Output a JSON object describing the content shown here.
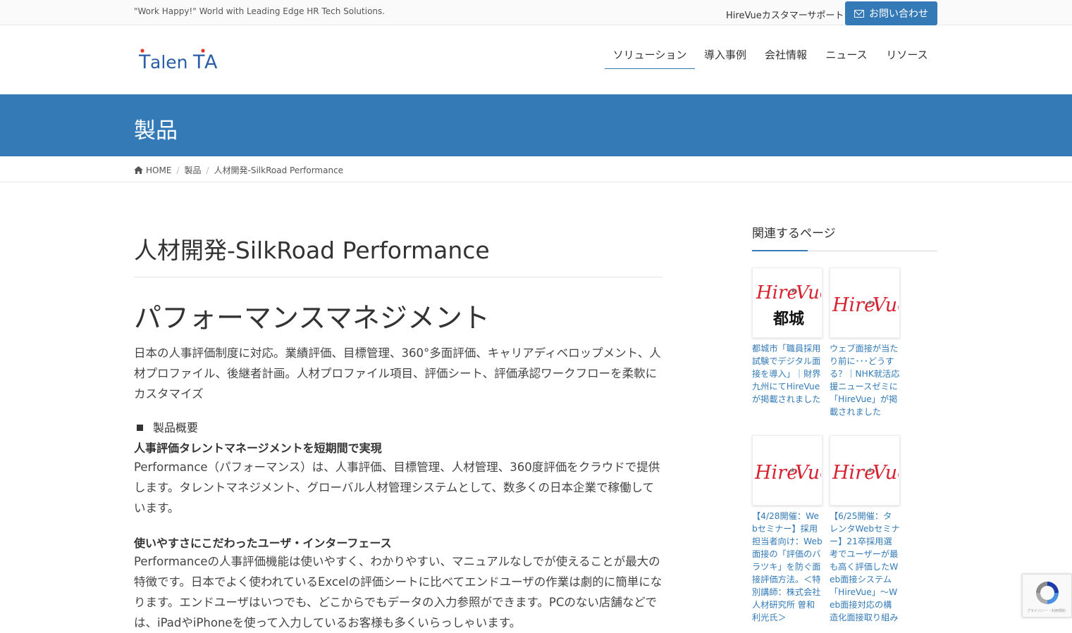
{
  "topbar": {
    "tagline": "\"Work Happy!\" World with Leading Edge HR Tech Solutions.",
    "support_link": "HireVueカスタマーサポート",
    "contact_button": "お問い合わせ"
  },
  "brand": {
    "logo_text": "TalenTA",
    "colors": {
      "primary": "#337ab7",
      "logo_blue": "#2a5ea8",
      "logo_red": "#e8332a"
    }
  },
  "nav": {
    "items": [
      {
        "label": "ソリューション",
        "active": true
      },
      {
        "label": "導入事例"
      },
      {
        "label": "会社情報"
      },
      {
        "label": "ニュース"
      },
      {
        "label": "リソース"
      }
    ]
  },
  "band": {
    "title": "製品"
  },
  "breadcrumb": {
    "home": "HOME",
    "level1": "製品",
    "current": "人材開発-SilkRoad Performance"
  },
  "main": {
    "page_title": "人材開発-SilkRoad Performance",
    "heading": "パフォーマンスマネジメント",
    "lead": "日本の人事評価制度に対応。業績評価、目標管理、360°多面評価、キャリアディベロップメント、人材プロファイル、後継者計画。人材プロファイル項目、評価シート、評価承認ワークフローを柔軟にカスタマイズ",
    "overview_label": "製品概要",
    "section1_heading": "人事評価タレントマネージメントを短期間で実現",
    "section1_body": "Performance（パフォーマンス）は、人事評価、目標管理、人材管理、360度評価をクラウドで提供します。タレントマネジメント、グローバル人材管理システムとして、数多くの日本企業で稼働しています。",
    "section2_heading": "使いやすさにこだわったユーザ・インターフェース",
    "section2_body": "Performanceの人事評価機能は使いやすく、わかりやすい、マニュアルなしでが使えることが最大の特徴です。日本でよく使われているExcelの評価シートに比べてエンドユーザの作業は劇的に簡単になります。エンドユーザはいつでも、どこからでもデータの入力参照ができます。PCのない店舗などでは、iPadやiPhoneを使って入力しているお客様も多くいらっしゃいます。"
  },
  "sidebar": {
    "title": "関連するページ",
    "cards": [
      {
        "logo": "Hire Vue",
        "caption": "都城市「職員採用試験でデジタル面接を導入」｜財界九州にてHireVueが掲載されました"
      },
      {
        "logo": "Hire Vue",
        "caption": "ウェブ面接が当たり前に･･･どうする？｜NHK就活応援ニュースゼミに「HireVue」が掲載されました"
      },
      {
        "logo": "Hire Vue",
        "caption": "【4/28開催：Webセミナー】採用担当者向け：Web面接の「評価のバラツキ」を防ぐ面接評価方法。＜特別講師：株式会社人材研究所 曽和利光氏＞"
      },
      {
        "logo": "Hire Vue",
        "caption": "【6/25開催：タレンタWebセミナー】21卒採用選考でユーザーが最も高く評価したWeb面接システム「HireVue」～Web面接対応の構造化面接取り組み"
      }
    ]
  },
  "recaptcha": {
    "caption": "プライバシー・利用規約"
  }
}
